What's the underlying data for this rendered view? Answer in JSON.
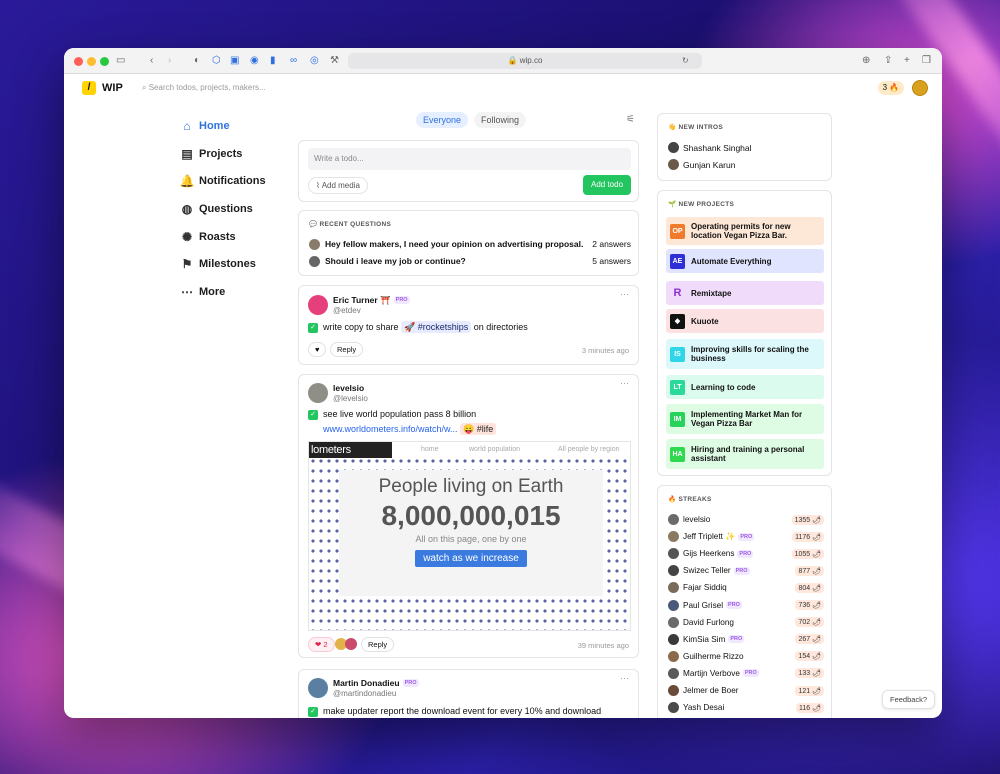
{
  "browser": {
    "url": "wip.co"
  },
  "app": {
    "name": "WIP",
    "logo_glyph": "/",
    "search_placeholder": "Search todos, projects, makers...",
    "streak_count": "3 🔥"
  },
  "nav": [
    {
      "label": "Home",
      "icon": "home-icon",
      "glyph": "⌂",
      "active": true
    },
    {
      "label": "Projects",
      "icon": "projects-icon",
      "glyph": "▤"
    },
    {
      "label": "Notifications",
      "icon": "bell-icon",
      "glyph": "🔔"
    },
    {
      "label": "Questions",
      "icon": "questions-icon",
      "glyph": "◍"
    },
    {
      "label": "Roasts",
      "icon": "roasts-icon",
      "glyph": "✺"
    },
    {
      "label": "Milestones",
      "icon": "flag-icon",
      "glyph": "⚑"
    },
    {
      "label": "More",
      "icon": "more-icon",
      "glyph": "⋯"
    }
  ],
  "feed_tabs": {
    "everyone": "Everyone",
    "following": "Following"
  },
  "composer": {
    "placeholder": "Write a todo...",
    "add_media": "Add media",
    "add_todo": "Add todo"
  },
  "recent_questions": {
    "title": "💬 RECENT QUESTIONS",
    "items": [
      {
        "text": "Hey fellow makers, I need your opinion on advertising proposal.",
        "count": "2 answers"
      },
      {
        "text": "Should i leave my job or continue?",
        "count": "5 answers"
      }
    ]
  },
  "posts": [
    {
      "name": "Eric Turner ⛩️",
      "pro": "PRO",
      "handle": "@etdev",
      "todo_pre": "write copy to share ",
      "tag": "🚀 #rocketships",
      "todo_post": " on directories",
      "reply": "Reply",
      "time": "3 minutes ago"
    },
    {
      "name": "levelsio",
      "handle": "@levelsio",
      "todo": "see live world population pass 8 billion",
      "link": "www.worldometers.info/watch/w...",
      "tag": "😛 #life",
      "likes": "❤ 2",
      "reply": "Reply",
      "time": "39 minutes ago",
      "preview": {
        "logo": "lometers",
        "nav1": "home",
        "nav2": "world population",
        "nav3": "All people by region",
        "line1": "People living on Earth",
        "line2": "8,000,000,015",
        "line3": "All on this page, one by one",
        "button": "watch as we increase"
      }
    },
    {
      "name": "Martin Donadieu",
      "pro": "PRO",
      "handle": "@martindonadieu",
      "todo": "make updater report the download event for every 10% and download"
    }
  ],
  "new_intros": {
    "title": "👋 NEW INTROS",
    "items": [
      "Shashank Singhal",
      "Gunjan Karun"
    ]
  },
  "new_projects": {
    "title": "🌱 NEW PROJECTS",
    "items": [
      {
        "badge": "OP",
        "name": "Operating permits for new location Vegan Pizza Bar.",
        "bg": "#fde8d8",
        "color": "#f07b2c"
      },
      {
        "badge": "AE",
        "name": "Automate Everything",
        "bg": "#e1e4ff",
        "color": "#2f2fd8"
      },
      {
        "badge": "R",
        "name": "Remixtape",
        "bg": "#f0dcfa",
        "color": "#f0dcfa"
      },
      {
        "badge": "◆",
        "name": "Kuuote",
        "bg": "#fbe1e1",
        "color": "#111111"
      },
      {
        "badge": "IS",
        "name": "Improving skills for scaling the business",
        "bg": "#dcf8fb",
        "color": "#2fd6e8"
      },
      {
        "badge": "LT",
        "name": "Learning to code",
        "bg": "#dcfbef",
        "color": "#2bd99a"
      },
      {
        "badge": "IM",
        "name": "Implementing Market Man for Vegan Pizza Bar",
        "bg": "#defbe4",
        "color": "#27d35a"
      },
      {
        "badge": "HA",
        "name": "Hiring and training a personal assistant",
        "bg": "#defbe4",
        "color": "#2ed84f"
      }
    ]
  },
  "streaks": {
    "title": "🔥 STREAKS",
    "items": [
      {
        "name": "levelsio",
        "score": "1355 🌶"
      },
      {
        "name": "Jeff Triplett ✨",
        "pro": "PRO",
        "score": "1176 🌶"
      },
      {
        "name": "Gijs Heerkens",
        "pro": "PRO",
        "score": "1055 🌶"
      },
      {
        "name": "Swizec Teller",
        "pro": "PRO",
        "score": "877 🌶"
      },
      {
        "name": "Fajar Siddiq",
        "score": "804 🌶"
      },
      {
        "name": "Paul Grisel",
        "pro": "PRO",
        "score": "736 🌶"
      },
      {
        "name": "David Furlong",
        "score": "702 🌶"
      },
      {
        "name": "KimSia Sim",
        "pro": "PRO",
        "score": "267 🌶"
      },
      {
        "name": "Guilherme Rizzo",
        "score": "154 🌶"
      },
      {
        "name": "Martijn Verbove",
        "pro": "PRO",
        "score": "133 🌶"
      },
      {
        "name": "Jelmer de Boer",
        "score": "121 🌶"
      },
      {
        "name": "Yash Desai",
        "score": "116 🌶"
      }
    ]
  },
  "feedback": "Feedback?"
}
